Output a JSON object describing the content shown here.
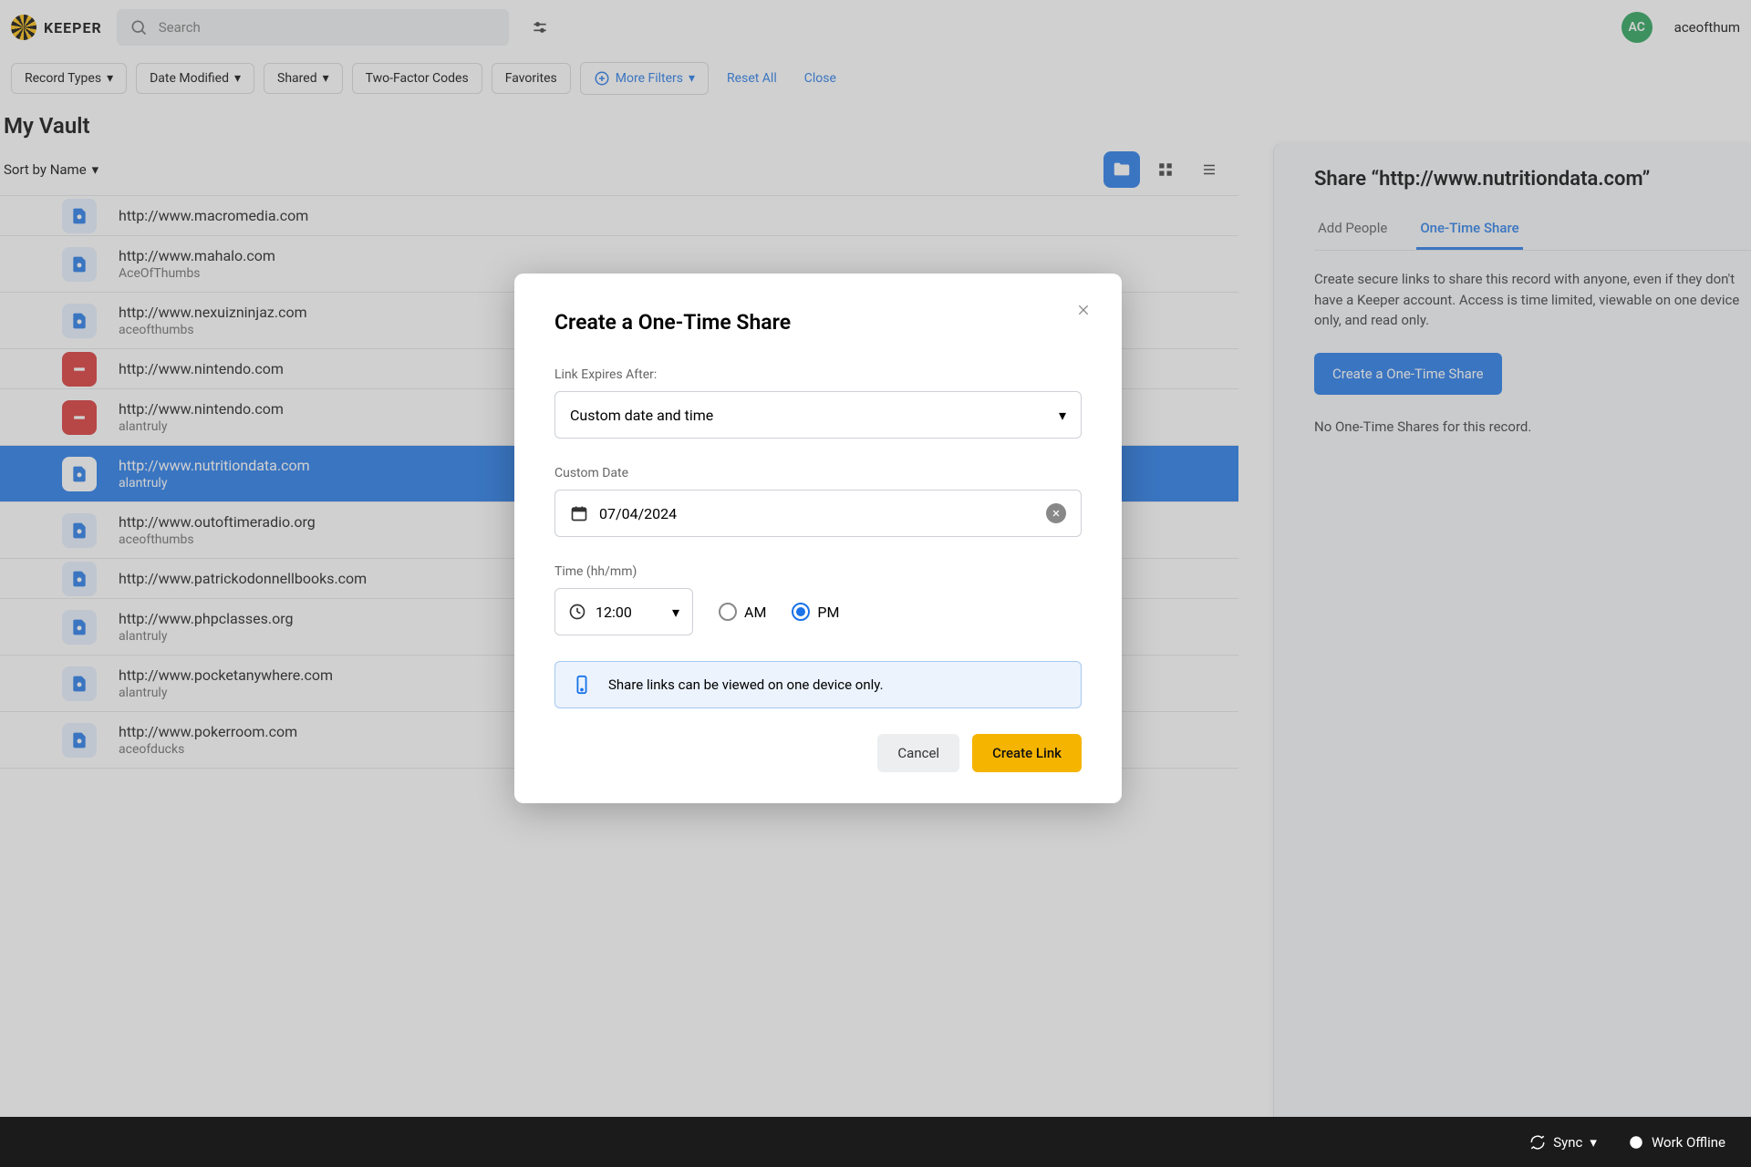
{
  "app": {
    "name": "KEEPER"
  },
  "search": {
    "placeholder": "Search"
  },
  "user": {
    "initials": "AC",
    "name": "aceofthum"
  },
  "filters": {
    "record_types": "Record Types",
    "date_modified": "Date Modified",
    "shared": "Shared",
    "two_factor": "Two-Factor Codes",
    "favorites": "Favorites",
    "more": "More Filters",
    "reset": "Reset All",
    "close": "Close"
  },
  "page": {
    "title": "My Vault",
    "sort": "Sort by Name"
  },
  "records": [
    {
      "title": "http://www.macromedia.com",
      "sub": "",
      "icon": "blue"
    },
    {
      "title": "http://www.mahalo.com",
      "sub": "AceOfThumbs",
      "icon": "blue"
    },
    {
      "title": "http://www.nexuizninjaz.com",
      "sub": "aceofthumbs",
      "icon": "blue"
    },
    {
      "title": "http://www.nintendo.com",
      "sub": "",
      "icon": "red"
    },
    {
      "title": "http://www.nintendo.com",
      "sub": "alantruly",
      "icon": "red"
    },
    {
      "title": "http://www.nutritiondata.com",
      "sub": "alantruly",
      "icon": "blue",
      "selected": true
    },
    {
      "title": "http://www.outoftimeradio.org",
      "sub": "aceofthumbs",
      "icon": "blue"
    },
    {
      "title": "http://www.patrickodonnellbooks.com",
      "sub": "",
      "icon": "blue"
    },
    {
      "title": "http://www.phpclasses.org",
      "sub": "alantruly",
      "icon": "blue"
    },
    {
      "title": "http://www.pocketanywhere.com",
      "sub": "alantruly",
      "icon": "blue"
    },
    {
      "title": "http://www.pokerroom.com",
      "sub": "aceofducks",
      "icon": "blue"
    }
  ],
  "panel": {
    "title": "Share “http://www.nutritiondata.com”",
    "tab_add": "Add People",
    "tab_ots": "One-Time Share",
    "desc": "Create secure links to share this record with anyone, even if they don't have a Keeper account. Access is time limited, viewable on one device only, and read only.",
    "cta": "Create a One-Time Share",
    "empty": "No One-Time Shares for this record."
  },
  "modal": {
    "title": "Create a One-Time Share",
    "expires_label": "Link Expires After:",
    "expires_value": "Custom date and time",
    "date_label": "Custom Date",
    "date_value": "07/04/2024",
    "time_label": "Time (hh/mm)",
    "time_value": "12:00",
    "am": "AM",
    "pm": "PM",
    "banner": "Share links can be viewed on one device only.",
    "cancel": "Cancel",
    "create": "Create Link"
  },
  "footer": {
    "sync": "Sync",
    "offline": "Work Offline"
  }
}
